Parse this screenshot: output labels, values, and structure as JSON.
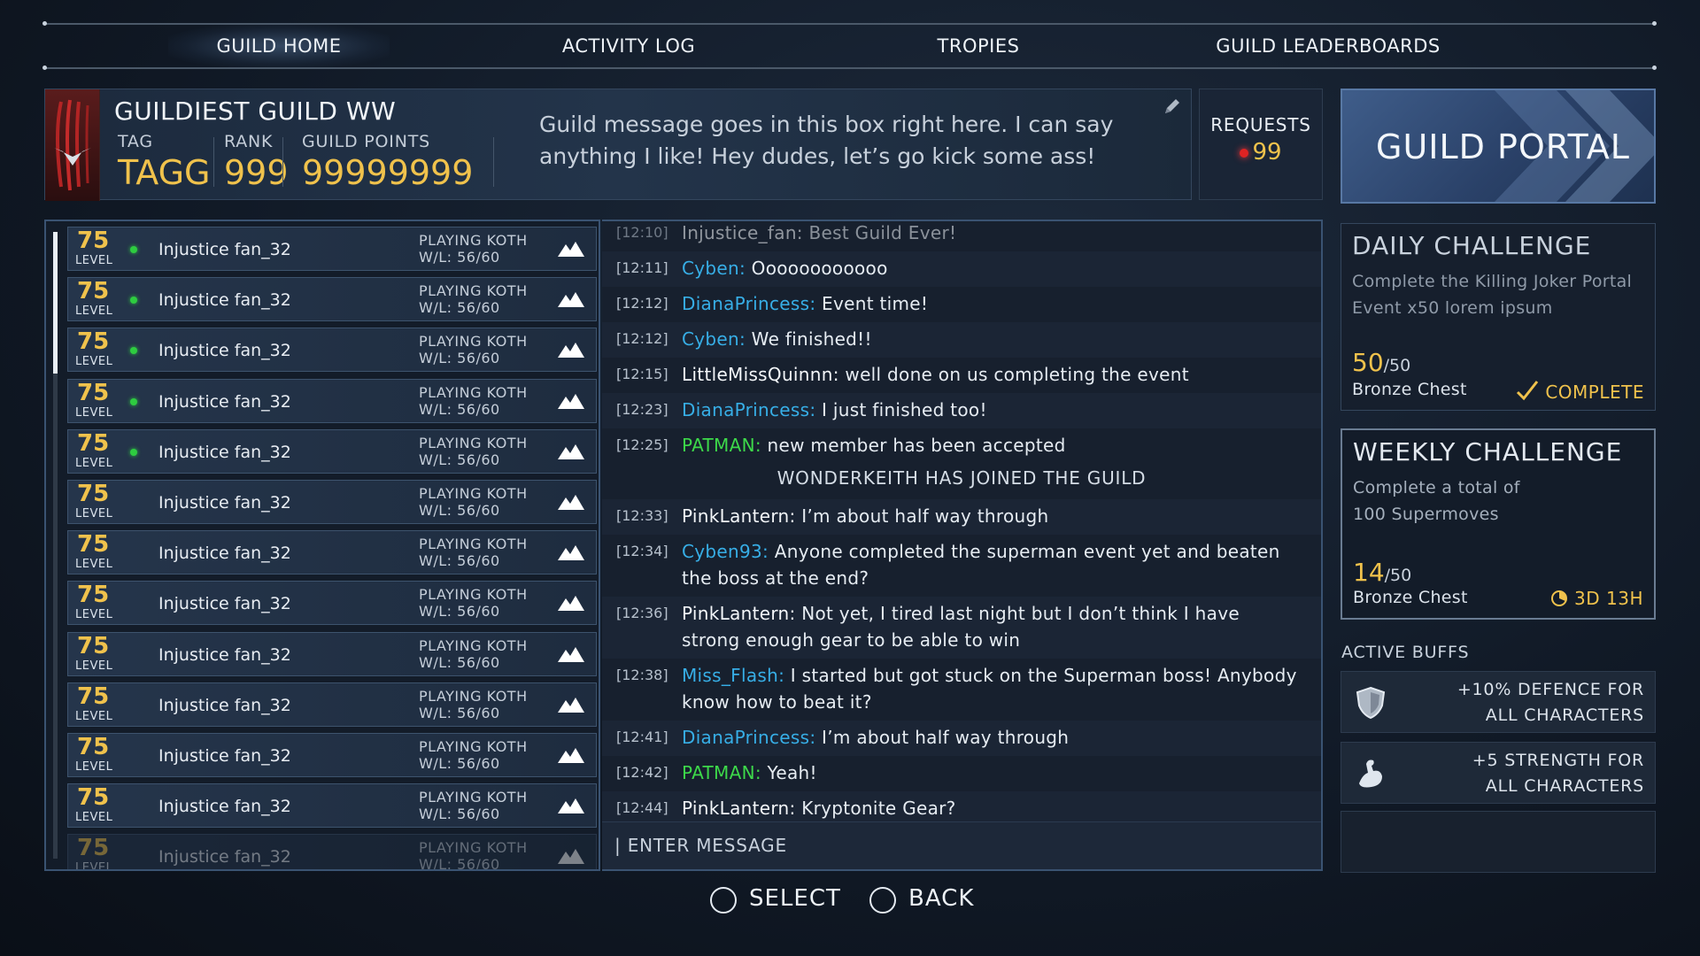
{
  "nav": {
    "tabs": [
      {
        "label": "GUILD HOME",
        "active": true
      },
      {
        "label": "ACTIVITY LOG",
        "active": false
      },
      {
        "label": "TROPIES",
        "active": false
      },
      {
        "label": "GUILD LEADERBOARDS",
        "active": false
      }
    ]
  },
  "guild": {
    "name": "GUILDIEST GUILD WW",
    "tag_label": "TAG",
    "tag": "TAGG",
    "rank_label": "RANK",
    "rank": "999",
    "points_label": "GUILD POINTS",
    "points": "99999999",
    "message": "Guild message goes in this box right here. I can say anything I like! Hey dudes, let’s go kick some ass!"
  },
  "requests": {
    "label": "REQUESTS",
    "count": "99"
  },
  "portal": {
    "label": "GUILD PORTAL"
  },
  "members": {
    "level_label": "LEVEL",
    "rows": [
      {
        "level": "75",
        "name": "Injustice fan_32",
        "status": "PLAYING KOTH",
        "wl": "W/L: 56/60",
        "online": true
      },
      {
        "level": "75",
        "name": "Injustice fan_32",
        "status": "PLAYING KOTH",
        "wl": "W/L: 56/60",
        "online": true
      },
      {
        "level": "75",
        "name": "Injustice fan_32",
        "status": "PLAYING KOTH",
        "wl": "W/L: 56/60",
        "online": true
      },
      {
        "level": "75",
        "name": "Injustice fan_32",
        "status": "PLAYING KOTH",
        "wl": "W/L: 56/60",
        "online": true
      },
      {
        "level": "75",
        "name": "Injustice fan_32",
        "status": "PLAYING KOTH",
        "wl": "W/L: 56/60",
        "online": true
      },
      {
        "level": "75",
        "name": "Injustice fan_32",
        "status": "PLAYING KOTH",
        "wl": "W/L: 56/60",
        "online": false
      },
      {
        "level": "75",
        "name": "Injustice fan_32",
        "status": "PLAYING KOTH",
        "wl": "W/L: 56/60",
        "online": false
      },
      {
        "level": "75",
        "name": "Injustice fan_32",
        "status": "PLAYING KOTH",
        "wl": "W/L: 56/60",
        "online": false
      },
      {
        "level": "75",
        "name": "Injustice fan_32",
        "status": "PLAYING KOTH",
        "wl": "W/L: 56/60",
        "online": false
      },
      {
        "level": "75",
        "name": "Injustice fan_32",
        "status": "PLAYING KOTH",
        "wl": "W/L: 56/60",
        "online": false
      },
      {
        "level": "75",
        "name": "Injustice fan_32",
        "status": "PLAYING KOTH",
        "wl": "W/L: 56/60",
        "online": false
      },
      {
        "level": "75",
        "name": "Injustice fan_32",
        "status": "PLAYING KOTH",
        "wl": "W/L: 56/60",
        "online": false
      },
      {
        "level": "75",
        "name": "Injustice fan_32",
        "status": "PLAYING KOTH",
        "wl": "W/L: 56/60",
        "online": false
      }
    ]
  },
  "chat": {
    "messages": [
      {
        "time": "[12:10]",
        "user": "Injustice_fan:",
        "text": " Best Guild Ever!",
        "color": "white"
      },
      {
        "time": "[12:11]",
        "user": "Cyben:",
        "text": " Oooooooooooo",
        "color": "blue"
      },
      {
        "time": "[12:12]",
        "user": "DianaPrincess:",
        "text": " Event time!",
        "color": "blue"
      },
      {
        "time": "[12:12]",
        "user": "Cyben:",
        "text": " We finished!!",
        "color": "blue"
      },
      {
        "time": "[12:15]",
        "user": "LittleMissQuinnn:",
        "text": " well done on us completing the event",
        "color": "white"
      },
      {
        "time": "[12:23]",
        "user": "DianaPrincess:",
        "text": " I just finished too!",
        "color": "blue"
      },
      {
        "time": "[12:25]",
        "user": "PATMAN:",
        "text": " new member has been accepted",
        "color": "green"
      },
      {
        "time": "[12:33]",
        "user": "PinkLantern:",
        "text": " I’m about half way through",
        "color": "white"
      },
      {
        "time": "[12:34]",
        "user": "Cyben93:",
        "text": " Anyone completed the superman event yet and beaten the boss at the end?",
        "color": "blue"
      },
      {
        "time": "[12:36]",
        "user": "PinkLantern:",
        "text": " Not yet, I tired last night but I don’t think I have strong enough gear to be able to win",
        "color": "white"
      },
      {
        "time": "[12:38]",
        "user": "Miss_Flash:",
        "text": " I started but got stuck on the Superman boss! Anybody know how to beat it?",
        "color": "blue"
      },
      {
        "time": "[12:41]",
        "user": "DianaPrincess:",
        "text": " I’m about half way through",
        "color": "blue"
      },
      {
        "time": "[12:42]",
        "user": "PATMAN:",
        "text": " Yeah!",
        "color": "green"
      },
      {
        "time": "[12:44]",
        "user": "PinkLantern:",
        "text": " Kryptonite Gear?",
        "color": "white"
      }
    ],
    "system_message": "WONDERKEITH HAS JOINED THE GUILD",
    "input_placeholder": "| ENTER MESSAGE"
  },
  "daily": {
    "title": "DAILY CHALLENGE",
    "desc": "Complete the Killing Joker Portal Event x50 lorem ipsum",
    "progress": "50",
    "goal": "/50",
    "reward": "Bronze Chest",
    "status": "COMPLETE"
  },
  "weekly": {
    "title": "WEEKLY CHALLENGE",
    "desc_line1": "Complete a total of",
    "desc_line2": "100 Supermoves",
    "progress": "14",
    "goal": "/50",
    "reward": "Bronze Chest",
    "timer": "3D 13H"
  },
  "buffs": {
    "label": "ACTIVE BUFFS",
    "items": [
      {
        "line1": "+10% DEFENCE FOR",
        "line2": "ALL CHARACTERS",
        "icon": "shield-icon"
      },
      {
        "line1": "+5 STRENGTH FOR",
        "line2": "ALL CHARACTERS",
        "icon": "flexed-arm-icon"
      }
    ]
  },
  "footer": {
    "select": "SELECT",
    "back": "BACK"
  }
}
